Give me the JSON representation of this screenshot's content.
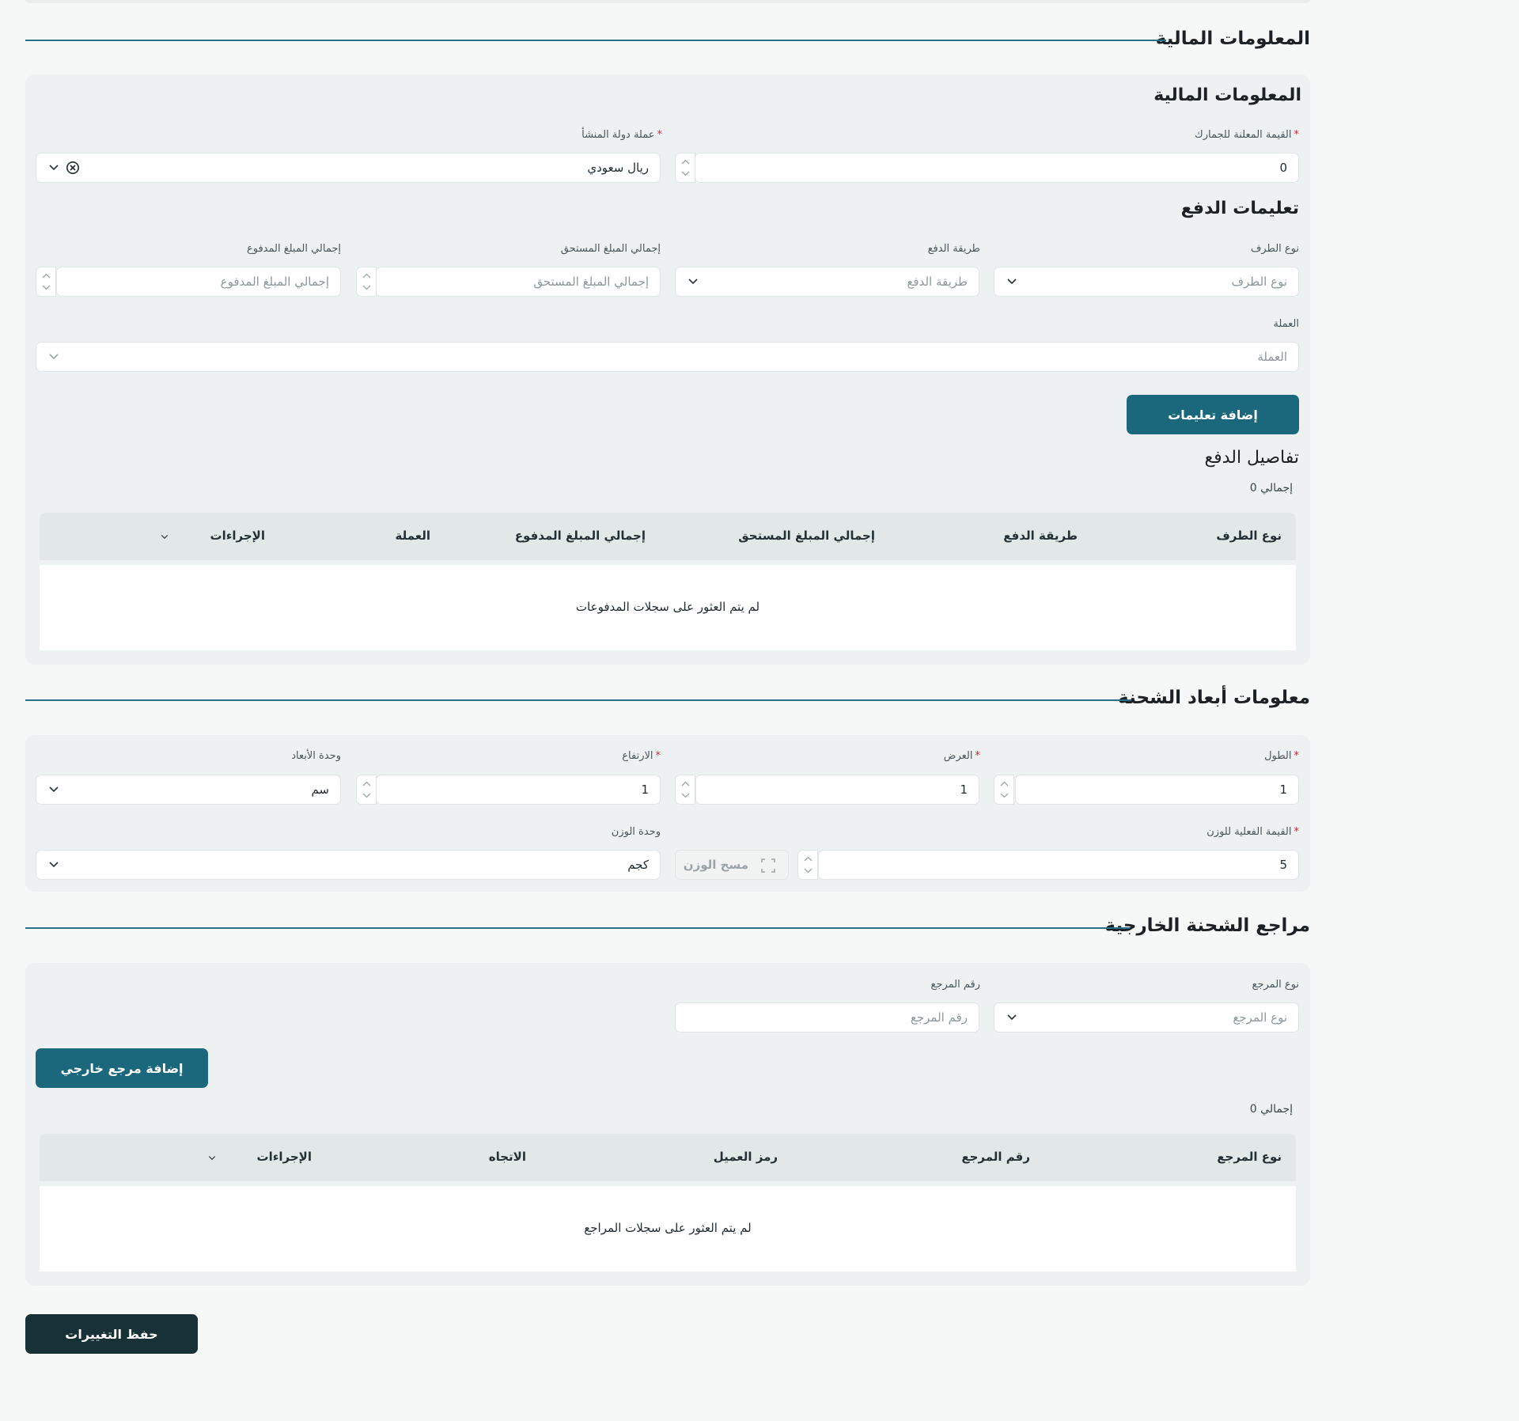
{
  "financial_section": {
    "title": "المعلومات المالية",
    "panel_title": "المعلومات المالية",
    "declared_value": {
      "label": "القيمة المعلنة للجمارك",
      "value": "0"
    },
    "origin_currency": {
      "label": "عملة دولة المنشأ",
      "value": "ريال سعودي"
    },
    "payment_instructions_title": "تعليمات الدفع",
    "party_type": {
      "label": "نوع الطرف",
      "placeholder": "نوع الطرف"
    },
    "payment_method": {
      "label": "طريقة الدفع",
      "placeholder": "طريقة الدفع"
    },
    "total_due": {
      "label": "إجمالي المبلغ المستحق",
      "placeholder": "إجمالي المبلغ المستحق"
    },
    "total_paid": {
      "label": "إجمالي المبلغ المدفوع",
      "placeholder": "إجمالي المبلغ المدفوع"
    },
    "currency": {
      "label": "العملة",
      "placeholder": "العملة"
    },
    "add_instructions_button": "إضافة تعليمات",
    "payment_details_title": "تفاصيل الدفع",
    "total_text": "إجمالي 0",
    "table": {
      "columns": [
        "نوع الطرف",
        "طريقة الدفع",
        "إجمالي المبلغ المستحق",
        "إجمالي المبلغ المدفوع",
        "العملة",
        "الإجراءات"
      ],
      "empty_text": "لم يتم العثور على سجلات المدفوعات"
    }
  },
  "dimensions_section": {
    "title": "معلومات أبعاد الشحنة",
    "length": {
      "label": "الطول",
      "value": "1"
    },
    "width": {
      "label": "العرض",
      "value": "1"
    },
    "height": {
      "label": "الارتفاع",
      "value": "1"
    },
    "dimension_unit": {
      "label": "وحدة الأبعاد",
      "value": "سم"
    },
    "actual_weight": {
      "label": "القيمة الفعلية للوزن",
      "value": "5"
    },
    "scan_weight_button": "مسح الوزن",
    "weight_unit": {
      "label": "وحدة الوزن",
      "value": "كجم"
    }
  },
  "references_section": {
    "title": "مراجع الشحنة الخارجية",
    "reference_type": {
      "label": "نوع المرجع",
      "placeholder": "نوع المرجع"
    },
    "reference_number": {
      "label": "رقم المرجع",
      "placeholder": "رقم المرجع"
    },
    "add_reference_button": "إضافة مرجع خارجي",
    "total_text": "إجمالي 0",
    "table": {
      "columns": [
        "نوع المرجع",
        "رقم المرجع",
        "رمز العميل",
        "الاتجاه",
        "الإجراءات"
      ],
      "empty_text": "لم يتم العثور على سجلات المراجع"
    }
  },
  "save_button": "حفظ التغييرات",
  "colors": {
    "accent": "#1b687c",
    "dark_button": "#183136",
    "required": "#d7263d",
    "section_line": "#2a6f84"
  },
  "icons": [
    "chevron-down-icon",
    "clear-circle-icon",
    "stepper-up-icon",
    "stepper-down-icon",
    "scan-frame-icon"
  ]
}
